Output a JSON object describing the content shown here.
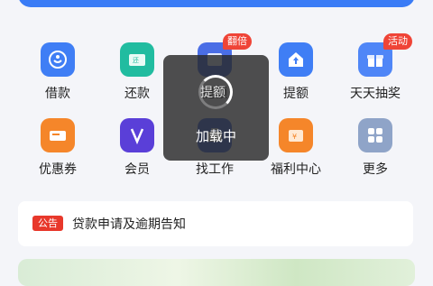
{
  "colors": {
    "accent_blue": "#3a7cf6",
    "repay_teal": "#21bca0",
    "member_purple": "#5a3fd8",
    "orange": "#f5862a",
    "badge_red": "#ef4437",
    "more_gray": "#8fa4c8"
  },
  "grid": {
    "row1": [
      {
        "label": "借款",
        "icon": "loan-icon"
      },
      {
        "label": "还款",
        "icon": "repay-icon"
      },
      {
        "label": "提额",
        "icon": "quota-icon",
        "badge": "翻倍"
      },
      {
        "label": "提额",
        "icon": "raise-limit-icon"
      },
      {
        "label": "天天抽奖",
        "icon": "gift-icon",
        "badge": "活动"
      }
    ],
    "row2": [
      {
        "label": "优惠券",
        "icon": "coupon-icon"
      },
      {
        "label": "会员",
        "icon": "member-icon"
      },
      {
        "label": "找工作",
        "icon": "job-icon"
      },
      {
        "label": "福利中心",
        "icon": "welfare-icon"
      },
      {
        "label": "更多",
        "icon": "more-icon"
      }
    ]
  },
  "notice": {
    "badge": "公告",
    "text": "贷款申请及逾期告知"
  },
  "loading": {
    "text": "加载中",
    "ghost_label": "提额"
  }
}
